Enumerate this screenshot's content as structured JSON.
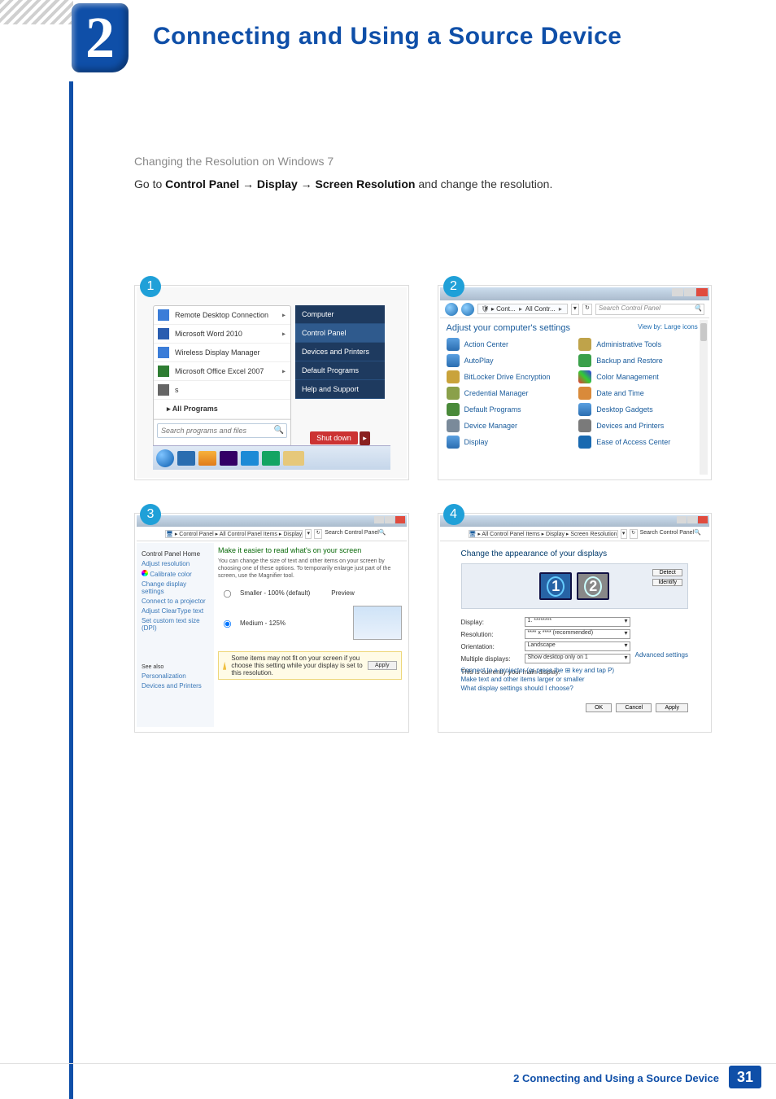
{
  "chapter": {
    "number": "2",
    "title": "Connecting and Using a Source Device"
  },
  "body": {
    "subhead": "Changing the Resolution on Windows 7",
    "instr_prefix": "Go to ",
    "instr_bold": "Control Panel → Display → Screen Resolution",
    "instr_suffix": " and change the resolution."
  },
  "steps": {
    "s1": "1",
    "s2": "2",
    "s3": "3",
    "s4": "4"
  },
  "panel1": {
    "progs": {
      "rdc": "Remote Desktop Connection",
      "word": "Microsoft Word 2010",
      "wdm": "Wireless Display Manager",
      "excel": "Microsoft Office Excel 2007",
      "sticky": "s",
      "all": "All Programs"
    },
    "search_placeholder": "Search programs and files",
    "right": {
      "computer": "Computer",
      "cp": "Control Panel",
      "devprint": "Devices and Printers",
      "defprog": "Default Programs",
      "help": "Help and Support"
    },
    "shutdown": "Shut down"
  },
  "panel2": {
    "crumb1": "Cont...",
    "crumb2": "All Contr...",
    "search_placeholder": "Search Control Panel",
    "header": "Adjust your computer's settings",
    "viewby_label": "View by:",
    "viewby_value": "Large icons",
    "items": {
      "action": "Action Center",
      "admin": "Administrative Tools",
      "autoplay": "AutoPlay",
      "backup": "Backup and Restore",
      "bitlocker": "BitLocker Drive Encryption",
      "color": "Color Management",
      "cred": "Credential Manager",
      "date": "Date and Time",
      "defprog": "Default Programs",
      "gadgets": "Desktop Gadgets",
      "devmgr": "Device Manager",
      "devprint": "Devices and Printers",
      "display": "Display",
      "ease": "Ease of Access Center"
    }
  },
  "panel3": {
    "crumb": "Control Panel  ▸  All Control Panel Items  ▸  Display",
    "search_placeholder": "Search Control Panel",
    "side": {
      "home": "Control Panel Home",
      "adjres": "Adjust resolution",
      "calib": "Calibrate color",
      "chdisp": "Change display settings",
      "proj": "Connect to a projector",
      "ctype": "Adjust ClearType text",
      "custom": "Set custom text size (DPI)",
      "seealso": "See also",
      "pers": "Personalization",
      "devpr": "Devices and Printers"
    },
    "main": {
      "title": "Make it easier to read what's on your screen",
      "desc": "You can change the size of text and other items on your screen by choosing one of these options. To temporarily enlarge just part of the screen, use the Magnifier tool.",
      "opt1": "Smaller - 100% (default)",
      "preview_label": "Preview",
      "opt2": "Medium - 125%",
      "warn": "Some items may not fit on your screen if you choose this setting while your display is set to this resolution.",
      "apply": "Apply"
    }
  },
  "panel4": {
    "crumb": "All Control Panel Items  ▸  Display  ▸  Screen Resolution",
    "search_placeholder": "Search Control Panel",
    "header": "Change the appearance of your displays",
    "detect": "Detect",
    "identify": "Identify",
    "mon1": "1",
    "mon2": "2",
    "labels": {
      "display": "Display:",
      "res": "Resolution:",
      "orient": "Orientation:",
      "multi": "Multiple displays:"
    },
    "values": {
      "display": "1. ********",
      "res": "**** x **** (recommended)",
      "orient": "Landscape",
      "multi": "Show desktop only on 1"
    },
    "maindisp": "This is currently your main display.",
    "adv": "Advanced settings",
    "links": {
      "proj": "Connect to a projector (or press the ⊞ key and tap P)",
      "text": "Make text and other items larger or smaller",
      "what": "What display settings should I choose?"
    },
    "btns": {
      "ok": "OK",
      "cancel": "Cancel",
      "apply": "Apply"
    }
  },
  "footer": {
    "text": "2 Connecting and Using a Source Device",
    "page": "31"
  }
}
